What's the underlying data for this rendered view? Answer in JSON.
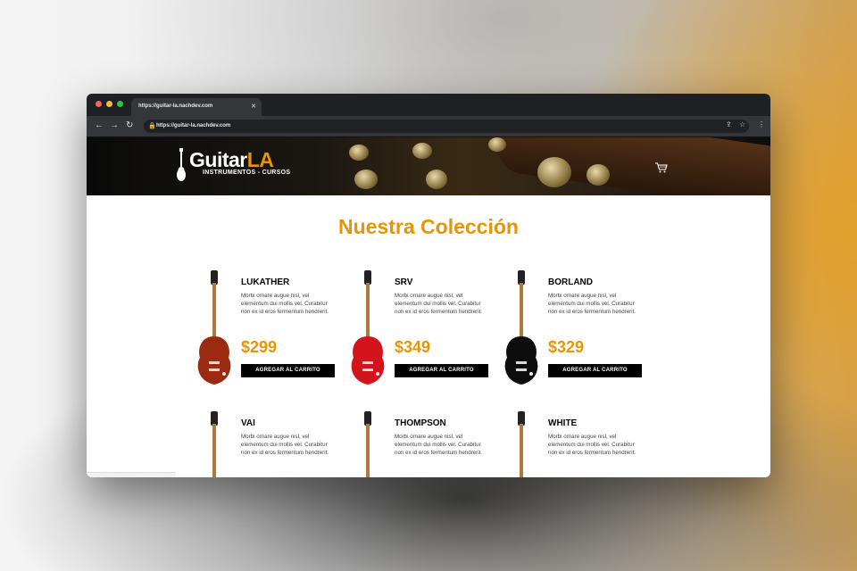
{
  "browser": {
    "tab_title": "https://guitar-la.nachdev.com",
    "url": "https://guitar-la.nachdev.com"
  },
  "header": {
    "logo_main": "Guitar",
    "logo_accent": "LA",
    "logo_sub": "INSTRUMENTOS - CURSOS",
    "cart_icon": "cart-icon"
  },
  "main": {
    "heading": "Nuestra Colección",
    "products": [
      {
        "name": "LUKATHER",
        "description": "Morbi ornare augue nisl, vel elementum dui mollis vel. Curabitur non ex id eros fermentum hendrerit.",
        "price": "$299",
        "button": "AGREGAR AL CARRITO",
        "color": "#9b2a10"
      },
      {
        "name": "SRV",
        "description": "Morbi ornare augue nisl, vel elementum dui mollis vel. Curabitur non ex id eros fermentum hendrerit.",
        "price": "$349",
        "button": "AGREGAR AL CARRITO",
        "color": "#d4141c"
      },
      {
        "name": "BORLAND",
        "description": "Morbi ornare augue nisl, vel elementum dui mollis vel. Curabitur non ex id eros fermentum hendrerit.",
        "price": "$329",
        "button": "AGREGAR AL CARRITO",
        "color": "#0d0d0d"
      },
      {
        "name": "VAI",
        "description": "Morbi ornare augue nisl, vel elementum dui mollis vel. Curabitur non ex id eros fermentum hendrerit.",
        "color": "#c05010"
      },
      {
        "name": "THOMPSON",
        "description": "Morbi ornare augue nisl, vel elementum dui mollis vel. Curabitur non ex id eros fermentum hendrerit.",
        "color": "#1a3a8a"
      },
      {
        "name": "WHITE",
        "description": "Morbi ornare augue nisl, vel elementum dui mollis vel. Curabitur non ex id eros fermentum hendrerit.",
        "color": "#b03020"
      }
    ]
  },
  "colors": {
    "accent": "#e99401",
    "button_bg": "#000000"
  }
}
